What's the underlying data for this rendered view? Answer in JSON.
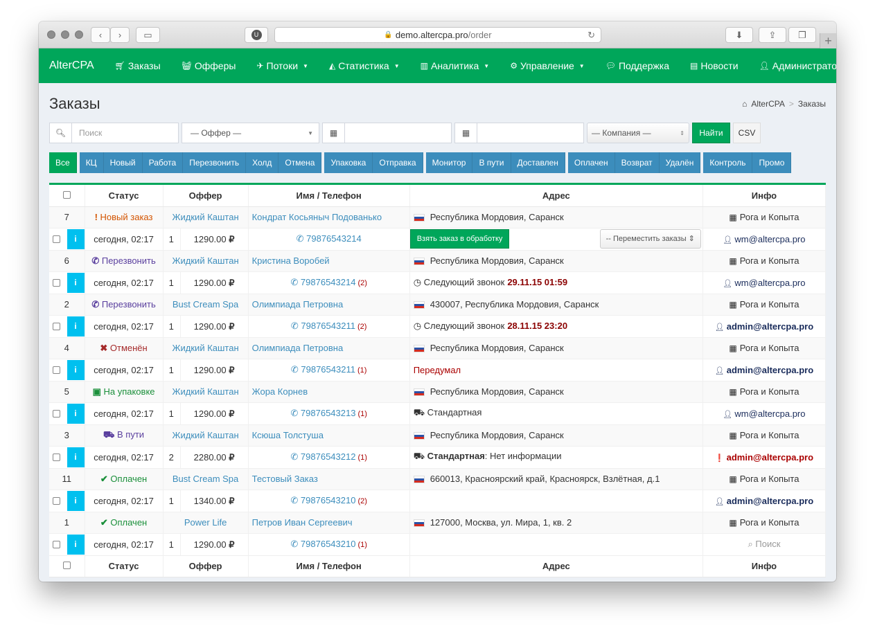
{
  "browser": {
    "url_domain": "demo.altercpa.pro",
    "url_path": "/order"
  },
  "navbar": {
    "brand": "AlterCPA",
    "items": [
      {
        "label": "Заказы",
        "icon": "cart-icon",
        "dropdown": false
      },
      {
        "label": "Офферы",
        "icon": "basket-icon",
        "dropdown": false
      },
      {
        "label": "Потоки",
        "icon": "paper-plane-icon",
        "dropdown": true
      },
      {
        "label": "Статистика",
        "icon": "area-chart-icon",
        "dropdown": true
      },
      {
        "label": "Аналитика",
        "icon": "bar-chart-icon",
        "dropdown": true
      },
      {
        "label": "Управление",
        "icon": "cogs-icon",
        "dropdown": true
      },
      {
        "label": "Поддержка",
        "icon": "comments-icon",
        "dropdown": false
      },
      {
        "label": "Новости",
        "icon": "newspaper-icon",
        "dropdown": false
      },
      {
        "label": "Администратор",
        "icon": "user-icon",
        "dropdown": false
      }
    ]
  },
  "page": {
    "title": "Заказы",
    "breadcrumb": [
      "AlterCPA",
      "Заказы"
    ]
  },
  "filters": {
    "search_placeholder": "Поиск",
    "offer_select": "— Оффер —",
    "company_select": "— Компания —",
    "find_button": "Найти",
    "csv_button": "CSV"
  },
  "status_buttons": [
    [
      "Все"
    ],
    [
      "КЦ",
      "Новый",
      "Работа",
      "Перезвонить",
      "Холд",
      "Отмена"
    ],
    [
      "Упаковка",
      "Отправка"
    ],
    [
      "Монитор",
      "В пути",
      "Доставлен"
    ],
    [
      "Оплачен",
      "Возврат",
      "Удалён"
    ],
    [
      "Контроль",
      "Промо"
    ]
  ],
  "table": {
    "headers": [
      "Статус",
      "Оффер",
      "Имя / Телефон",
      "Адрес",
      "Инфо"
    ],
    "take_order_button": "Взять заказ в обработку",
    "move_orders_select": "-- Переместить заказы",
    "orders": [
      {
        "id": "7",
        "status": "Новый заказ",
        "status_color": "#d35400",
        "status_icon": "!",
        "offer": "Жидкий Каштан",
        "name": "Кондрат Косьяныч Подованько",
        "address": "Республика Мордовия, Саранск",
        "company": "Рога и Копыта",
        "date": "сегодня, 02:17",
        "qty": "1",
        "price": "1290.00",
        "phone": "79876543214",
        "calls": "",
        "addr2_label": "",
        "addr2_value": "",
        "user": "wm@altercpa.pro",
        "user_bold": false,
        "user_alert": false
      },
      {
        "id": "6",
        "status": "Перезвонить",
        "status_color": "#5a3f9e",
        "status_icon": "✆",
        "offer": "Жидкий Каштан",
        "name": "Кристина Воробей",
        "address": "Республика Мордовия, Саранск",
        "company": "Рога и Копыта",
        "date": "сегодня, 02:17",
        "qty": "1",
        "price": "1290.00",
        "phone": "79876543214",
        "calls": "(2)",
        "addr2_label": "Следующий звонок",
        "addr2_value": "29.11.15 01:59",
        "user": "wm@altercpa.pro",
        "user_bold": false,
        "user_alert": false
      },
      {
        "id": "2",
        "status": "Перезвонить",
        "status_color": "#5a3f9e",
        "status_icon": "✆",
        "offer": "Bust Cream Spa",
        "name": "Олимпиада Петровна",
        "address": "430007, Республика Мордовия, Саранск",
        "company": "Рога и Копыта",
        "date": "сегодня, 02:17",
        "qty": "1",
        "price": "1290.00",
        "phone": "79876543211",
        "calls": "(2)",
        "addr2_label": "Следующий звонок",
        "addr2_value": "28.11.15 23:20",
        "user": "admin@altercpa.pro",
        "user_bold": true,
        "user_alert": false
      },
      {
        "id": "4",
        "status": "Отменён",
        "status_color": "#a52a2a",
        "status_icon": "✖",
        "offer": "Жидкий Каштан",
        "name": "Олимпиада Петровна",
        "address": "Республика Мордовия, Саранск",
        "company": "Рога и Копыта",
        "date": "сегодня, 02:17",
        "qty": "1",
        "price": "1290.00",
        "phone": "79876543211",
        "calls": "(1)",
        "addr2_label": "Передумал",
        "addr2_value": "",
        "user": "admin@altercpa.pro",
        "user_bold": true,
        "user_alert": false
      },
      {
        "id": "5",
        "status": "На упаковке",
        "status_color": "#1a8f3a",
        "status_icon": "▣",
        "offer": "Жидкий Каштан",
        "name": "Жора Корнев",
        "address": "Республика Мордовия, Саранск",
        "company": "Рога и Копыта",
        "date": "сегодня, 02:17",
        "qty": "1",
        "price": "1290.00",
        "phone": "79876543213",
        "calls": "(1)",
        "addr2_label": "Стандартная",
        "addr2_value": "",
        "user": "wm@altercpa.pro",
        "user_bold": false,
        "user_alert": false
      },
      {
        "id": "3",
        "status": "В пути",
        "status_color": "#5a3f9e",
        "status_icon": "⛟",
        "offer": "Жидкий Каштан",
        "name": "Ксюша Толстуша",
        "address": "Республика Мордовия, Саранск",
        "company": "Рога и Копыта",
        "date": "сегодня, 02:17",
        "qty": "2",
        "price": "2280.00",
        "phone": "79876543212",
        "calls": "(1)",
        "addr2_label": "Стандартная",
        "addr2_value": ": Нет информации",
        "user": "admin@altercpa.pro",
        "user_bold": true,
        "user_alert": true
      },
      {
        "id": "11",
        "status": "Оплачен",
        "status_color": "#1a8f3a",
        "status_icon": "✔",
        "offer": "Bust Cream Spa",
        "name": "Тестовый Заказ",
        "address": "660013, Красноярский край, Красноярск, Взлётная, д.1",
        "company": "Рога и Копыта",
        "date": "сегодня, 02:17",
        "qty": "1",
        "price": "1340.00",
        "phone": "79876543210",
        "calls": "(2)",
        "addr2_label": "",
        "addr2_value": "",
        "user": "admin@altercpa.pro",
        "user_bold": true,
        "user_alert": false
      },
      {
        "id": "1",
        "status": "Оплачен",
        "status_color": "#1a8f3a",
        "status_icon": "✔",
        "offer": "Power Life",
        "name": "Петров Иван Сергеевич",
        "address": "127000, Москва, ул. Мира, 1, кв. 2",
        "company": "Рога и Копыта",
        "date": "сегодня, 02:17",
        "qty": "1",
        "price": "1290.00",
        "phone": "79876543210",
        "calls": "(1)",
        "addr2_label": "",
        "addr2_value": "",
        "user": "Поиск",
        "user_bold": false,
        "user_alert": false
      }
    ]
  }
}
